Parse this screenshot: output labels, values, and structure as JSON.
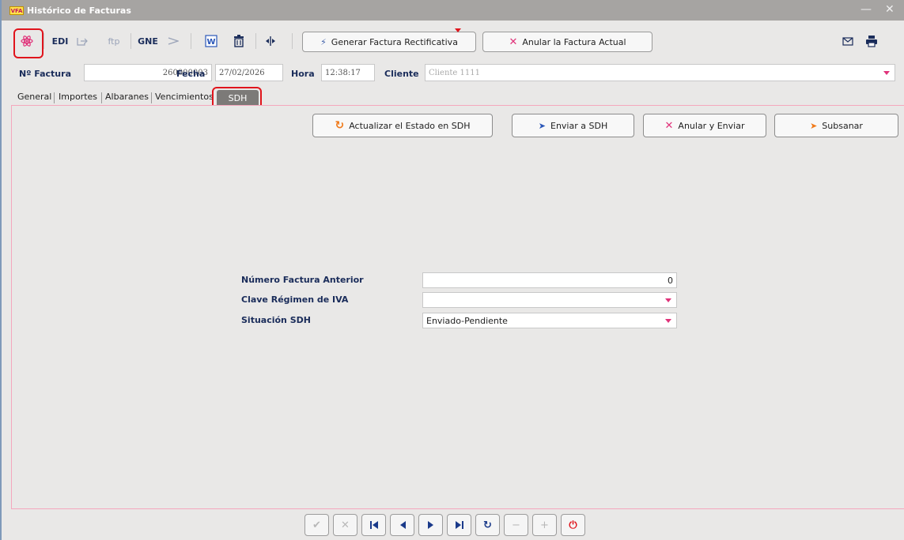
{
  "window": {
    "logo_text": "VFA",
    "title": "Histórico de Facturas",
    "minimize_glyph": "—",
    "close_glyph": "✕"
  },
  "toolbar": {
    "atom_icon": "atom-icon",
    "edi_label": "EDI",
    "export_icon": "export-icon",
    "ftp_label": "ftp",
    "gne_label": "GNE",
    "send_icon": "send-arrow-icon",
    "word_icon": "word-icon",
    "trash_icon": "trash-icon",
    "chart_icon": "split-icon",
    "rectificativa_label": "Generar Factura Rectificativa",
    "anular_label": "Anular la Factura Actual",
    "mail_icon": "mail-icon",
    "print_icon": "print-icon"
  },
  "fields": {
    "nfactura_label": "Nº Factura",
    "nfactura_value": "260000003",
    "fecha_label": "Fecha",
    "fecha_value": "27/02/2026",
    "hora_label": "Hora",
    "hora_value": "12:38:17",
    "cliente_label": "Cliente",
    "cliente_value": "Cliente 1111"
  },
  "tabs": [
    {
      "label": "General"
    },
    {
      "label": "Importes"
    },
    {
      "label": "Albaranes"
    },
    {
      "label": "Vencimientos"
    },
    {
      "label": "SDH"
    }
  ],
  "actions": {
    "actualizar_label": "Actualizar el Estado en SDH",
    "enviar_label": "Enviar a SDH",
    "anular_enviar_label": "Anular y Enviar",
    "subsanar_label": "Subsanar"
  },
  "form": {
    "numero_label": "Número Factura Anterior",
    "numero_value": "0",
    "clave_label": "Clave Régimen de IVA",
    "clave_value": "",
    "situacion_label": "Situación SDH",
    "situacion_value": "Enviado-Pendiente"
  },
  "colors": {
    "accent_pink": "#e0337a",
    "highlight_red": "#e0141c",
    "tab_active": "#7c7a78",
    "label_blue": "#1a2c5a"
  }
}
